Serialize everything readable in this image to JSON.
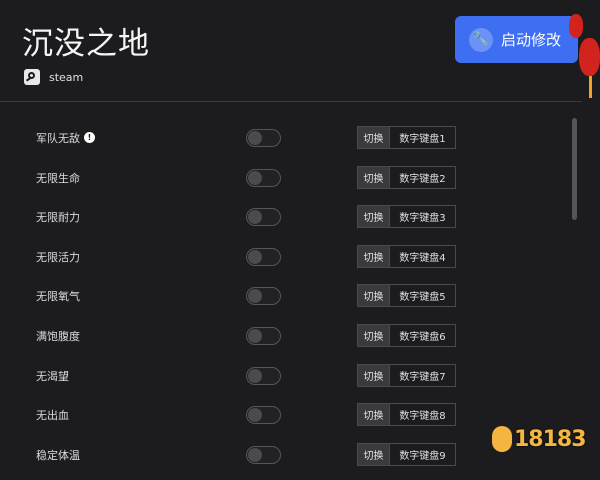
{
  "header": {
    "title": "沉没之地",
    "platform_label": "steam",
    "launch_label": "启动修改"
  },
  "cheats": [
    {
      "name": "军队无敌",
      "has_warning": true,
      "enabled": false,
      "mode": "切换",
      "key": "数字键盘1"
    },
    {
      "name": "无限生命",
      "has_warning": false,
      "enabled": false,
      "mode": "切换",
      "key": "数字键盘2"
    },
    {
      "name": "无限耐力",
      "has_warning": false,
      "enabled": false,
      "mode": "切换",
      "key": "数字键盘3"
    },
    {
      "name": "无限活力",
      "has_warning": false,
      "enabled": false,
      "mode": "切换",
      "key": "数字键盘4"
    },
    {
      "name": "无限氧气",
      "has_warning": false,
      "enabled": false,
      "mode": "切换",
      "key": "数字键盘5"
    },
    {
      "name": "满饱腹度",
      "has_warning": false,
      "enabled": false,
      "mode": "切换",
      "key": "数字键盘6"
    },
    {
      "name": "无渴望",
      "has_warning": false,
      "enabled": false,
      "mode": "切换",
      "key": "数字键盘7"
    },
    {
      "name": "无出血",
      "has_warning": false,
      "enabled": false,
      "mode": "切换",
      "key": "数字键盘8"
    },
    {
      "name": "稳定体温",
      "has_warning": false,
      "enabled": false,
      "mode": "切换",
      "key": "数字键盘9"
    }
  ],
  "icons": {
    "platform": "steam-icon",
    "launch": "wrench-icon",
    "warning": "warning-icon"
  },
  "watermark": "18183",
  "colors": {
    "background": "#1c1c1f",
    "accent": "#3e6ef2",
    "warning": "#ffffff",
    "lantern": "#d2231f"
  }
}
